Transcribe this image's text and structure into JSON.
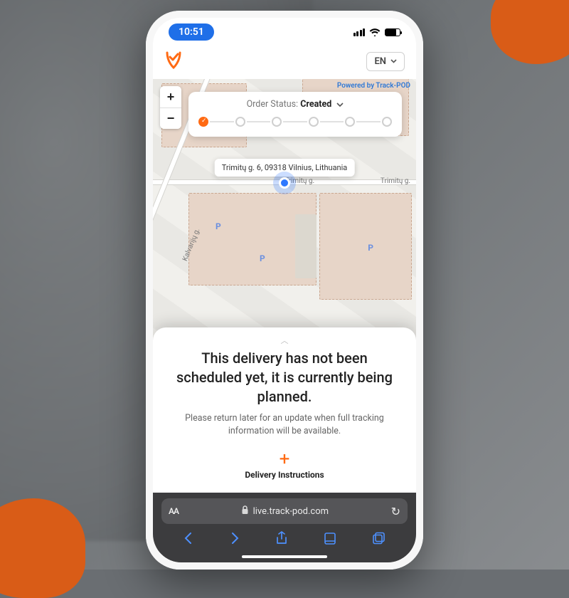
{
  "statusbar": {
    "time": "10:51"
  },
  "header": {
    "language": "EN"
  },
  "map": {
    "powered_by": "Powered by Track-POD",
    "street_label": "Trimitų g.",
    "kalvariu_label": "Kalvarijų g.",
    "parking_label": "P",
    "zoom_in": "+",
    "zoom_out": "−",
    "status_label": "Order Status:",
    "status_value": "Created",
    "address": "Trimitų g. 6, 09318 Vilnius, Lithuania"
  },
  "sheet": {
    "heading": "This delivery has not been scheduled yet, it is currently being planned.",
    "sub": "Please return later for an update when full tracking information will be available.",
    "instructions_label": "Delivery Instructions"
  },
  "safari": {
    "aa": "AA",
    "url": "live.track-pod.com"
  }
}
